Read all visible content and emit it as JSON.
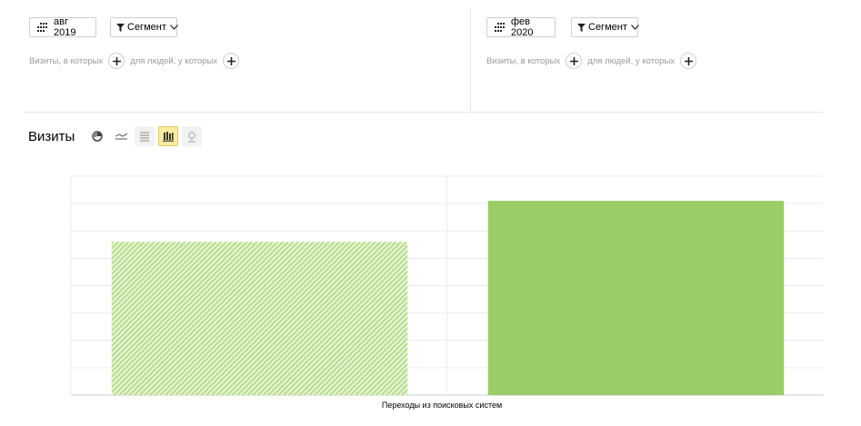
{
  "left_panel": {
    "period_label": "авг 2019",
    "segment_label": "Сегмент",
    "condition_visits_text": "Визиты, в которых",
    "condition_people_text": "для людей, у которых"
  },
  "right_panel": {
    "period_label": "фев 2020",
    "segment_label": "Сегмент",
    "condition_visits_text": "Визиты, в которых",
    "condition_people_text": "для людей, у которых"
  },
  "report": {
    "title": "Визиты",
    "view_buttons": [
      {
        "icon": "pie-chart-icon",
        "state": "normal"
      },
      {
        "icon": "line-chart-icon",
        "state": "normal"
      },
      {
        "icon": "stacked-area-icon",
        "state": "disabled"
      },
      {
        "icon": "bar-chart-icon",
        "state": "active"
      },
      {
        "icon": "map-pin-icon",
        "state": "disabled"
      }
    ]
  },
  "colors": {
    "bar_solid": "#9acd66",
    "bar_hatch": "#b5dd8a",
    "grid": "#ececec",
    "active_button": "#ffeba0"
  },
  "chart_data": {
    "type": "bar",
    "categories": [
      "Переходы из поисковых систем"
    ],
    "series": [
      {
        "name": "авг 2019",
        "values": [
          56
        ],
        "pattern": "hatched"
      },
      {
        "name": "фев 2020",
        "values": [
          71
        ],
        "pattern": "solid"
      }
    ],
    "ylim": [
      0,
      80
    ],
    "grid": true,
    "xlabel": "",
    "ylabel": ""
  }
}
